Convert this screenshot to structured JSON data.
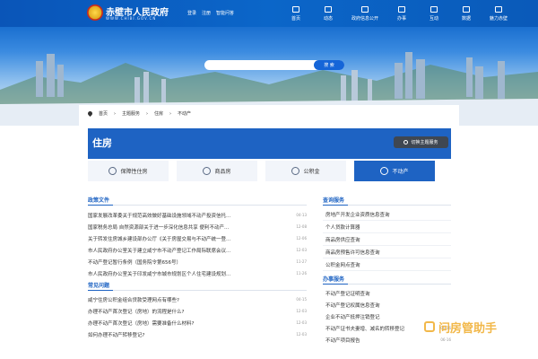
{
  "header": {
    "title": "赤壁市人民政府",
    "url": "WWW.CHIBI.GOV.CN",
    "top_links": [
      "登录",
      "注册",
      "智能问答"
    ],
    "nav": [
      {
        "label": "首页",
        "icon": "home-icon"
      },
      {
        "label": "动态",
        "icon": "news-icon"
      },
      {
        "label": "政府信息公开",
        "icon": "info-icon"
      },
      {
        "label": "办事",
        "icon": "service-icon"
      },
      {
        "label": "互动",
        "icon": "chat-icon"
      },
      {
        "label": "数据",
        "icon": "data-icon"
      },
      {
        "label": "魅力赤壁",
        "icon": "city-icon"
      }
    ]
  },
  "search": {
    "placeholder": "",
    "button": "搜 索"
  },
  "breadcrumb": [
    "首页",
    "主题服务",
    "住房",
    "不动产"
  ],
  "page_title": "住房",
  "switch_button": "切换主题服务",
  "tabs": [
    {
      "label": "保障性住房",
      "icon": "house-icon"
    },
    {
      "label": "商品房",
      "icon": "building-icon"
    },
    {
      "label": "公积金",
      "icon": "fund-icon"
    },
    {
      "label": "不动产",
      "icon": "property-icon"
    }
  ],
  "policy": {
    "heading": "政策文件",
    "items": [
      {
        "title": "国家发展改革委关于规范高效做好基础设施领域不动产投资信托...",
        "date": "04-13"
      },
      {
        "title": "国家税务总局 自然资源部关于进一步深化信息共享 便利不动产...",
        "date": "12-08"
      },
      {
        "title": "关于转发住房城乡建设部办公厅《关于房屋交易与不动产统一登...",
        "date": "12-06"
      },
      {
        "title": "市人民政府办公室关于建立咸宁市不动产登记工作局际联席会议...",
        "date": "12-03"
      },
      {
        "title": "不动产登记暂行条例（国务院令第656号）",
        "date": "11-27"
      },
      {
        "title": "市人民政府办公室关于印发咸宁市城市规划区个人住宅建设规划...",
        "date": "11-26"
      }
    ]
  },
  "faq": {
    "heading": "常见问题",
    "items": [
      {
        "title": "咸宁住房公积金组合贷款受理网点有哪些?",
        "date": "04-15"
      },
      {
        "title": "办理不动产首次登记（房地）的流程是什么?",
        "date": "12-03"
      },
      {
        "title": "办理不动产首次登记（房地）需要准备什么材料?",
        "date": "12-03"
      },
      {
        "title": "如何办理不动产转移登记?",
        "date": "12-03"
      }
    ]
  },
  "query": {
    "heading": "查询服务",
    "items": [
      "房地产开发企业资质信息查询",
      "个人贷款计算器",
      "商品房供应查询",
      "商品房预售许可信息查询",
      "公积金网点查询"
    ]
  },
  "handle": {
    "heading": "办事服务",
    "items": [
      {
        "title": "不动产登记证明查询",
        "date": ""
      },
      {
        "title": "不动产登记权属信息查询",
        "date": ""
      },
      {
        "title": "企业不动产抵押注销登记",
        "date": ""
      },
      {
        "title": "不动产证书夫妻增、减名的转移登记",
        "date": "06-16"
      },
      {
        "title": "不动产项目报告",
        "date": "06-16"
      }
    ]
  },
  "watermark": "问房管助手"
}
